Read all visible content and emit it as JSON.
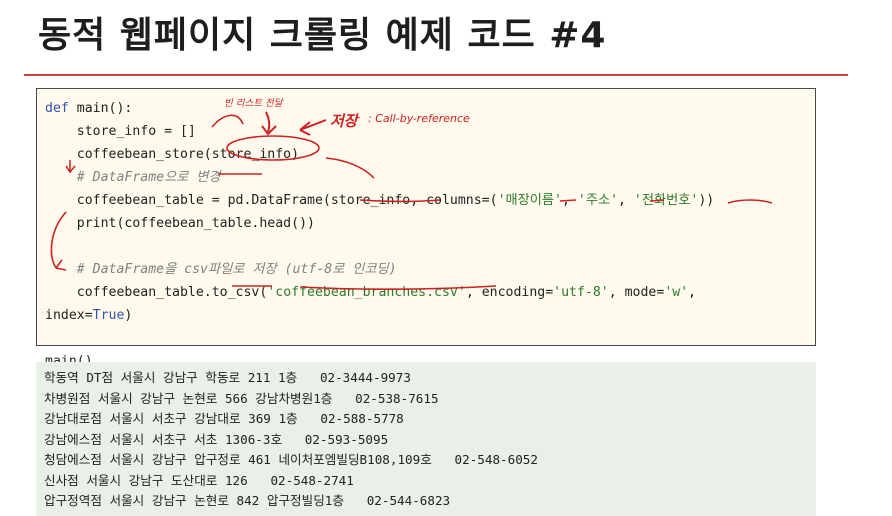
{
  "slide": {
    "title": "동적 웹페이지 크롤링 예제 코드 #4"
  },
  "code": {
    "line1_kw": "def",
    "line1_rest": " main():",
    "line2": "    store_info = []",
    "line3": "    coffeebean_store(store_info)",
    "line4_comment": "    # DataFrame으로 변경",
    "line5_a": "    coffeebean_table = pd.DataFrame(store_info, columns=(",
    "line5_s1": "'매장이름'",
    "line5_sep1": ", ",
    "line5_s2": "'주소'",
    "line5_sep2": ", ",
    "line5_s3": "'전화번호'",
    "line5_b": "))",
    "line6": "    print(coffeebean_table.head())",
    "line7_comment": "    # DataFrame을 csv파일로 저장 (utf-8로 인코딩)",
    "line8_a": "    coffeebean_table.to_csv(",
    "line8_s1": "'coffeebean_branches.csv'",
    "line8_b": ", encoding=",
    "line8_s2": "'utf-8'",
    "line8_c": ", mode=",
    "line8_s3": "'w'",
    "line8_d": ",",
    "line9_a": "index=",
    "line9_kw": "True",
    "line9_b": ")",
    "line11": "main()"
  },
  "annotations": {
    "empty_list_note": "빈 리스트 전달",
    "store_note": "저장",
    "reference_note": ": Call-by-reference"
  },
  "output": {
    "rows": [
      "학동역 DT점 서울시 강남구 학동로 211 1층   02-3444-9973",
      "차병원점 서울시 강남구 논현로 566 강남차병원1층   02-538-7615",
      "강남대로점 서울시 서초구 강남대로 369 1층   02-588-5778",
      "강남에스점 서울시 서초구 서초 1306-3호   02-593-5095",
      "청담에스점 서울시 강남구 압구정로 461 네이처포엠빌딩B108,109호   02-548-6052",
      "신사점 서울시 강남구 도산대로 126   02-548-2741",
      "압구정역점 서울시 강남구 논현로 842 압구정빌딩1층   02-544-6823"
    ]
  },
  "colors": {
    "title_rule": "#c9403b",
    "code_background": "#fffaed",
    "output_background": "#e9f0e8",
    "annotation_ink": "#cc2222",
    "keyword": "#2f54a8",
    "string": "#2c7a2c",
    "comment": "#808080"
  }
}
